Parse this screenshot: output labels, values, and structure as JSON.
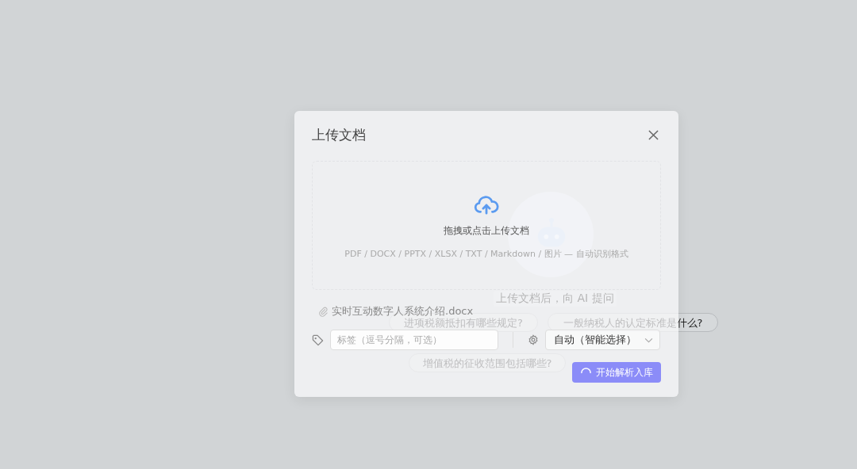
{
  "background": {
    "robot_caption": "上传文档后，向 AI 提问",
    "suggestions": [
      "进项税额抵扣有哪些规定?",
      "一般纳税人的认定标准是什么?",
      "增值税的征收范围包括哪些?"
    ]
  },
  "dialog": {
    "title": "上传文档",
    "dropzone": {
      "prompt": "拖拽或点击上传文档",
      "formats": "PDF / DOCX / PPTX / XLSX / TXT / Markdown / 图片 — 自动识别格式"
    },
    "file": {
      "name": "实时互动数字人系统介绍.docx"
    },
    "tags": {
      "placeholder": "标签（逗号分隔，可选）"
    },
    "parser": {
      "value": "自动（智能选择）"
    },
    "submit": {
      "label": "开始解析入库",
      "loading": true
    }
  }
}
